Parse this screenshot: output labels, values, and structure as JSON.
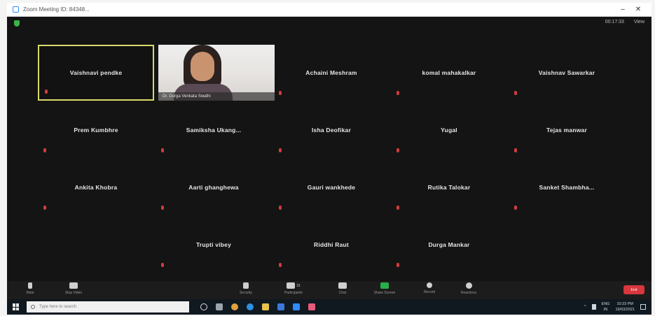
{
  "window": {
    "title": "Zoom Meeting ID: 84348..."
  },
  "top_right": [
    "00:17:33",
    "View"
  ],
  "video_participant": {
    "caption": "Dr. Durga Venkata Swathi"
  },
  "participants": [
    "Vaishnavi pendke",
    "Achaini Meshram",
    "komal mahakalkar",
    "Vaishnav Sawarkar",
    "Prem Kumbhre",
    "Samiksha  Ukang...",
    "Isha Deofikar",
    "Yugal",
    "Tejas manwar",
    "Ankita  Khobra",
    "Aarti ghanghewa",
    "Gauri wankhede",
    "Rutika Talokar",
    "Sanket  Shambha...",
    "Trupti vibey",
    "Riddhi Raut",
    "Durga Mankar"
  ],
  "toolbar": {
    "items": [
      "Mute",
      "Stop Video",
      "Security",
      "Participants",
      "Chat",
      "Share Screen",
      "Record",
      "Reactions"
    ],
    "participant_count": "31",
    "end_label": "End"
  },
  "taskbar": {
    "search_placeholder": "Type here to search",
    "lang": "ENG",
    "lang_sub": "IN",
    "time": "10:23 PM",
    "date": "19/03/2021"
  },
  "colors": {
    "meeting_bg": "#141414",
    "active_border": "#d8d96a",
    "mute_red": "#d23c3c",
    "end_red": "#d9363e",
    "share_green": "#28b04a"
  }
}
